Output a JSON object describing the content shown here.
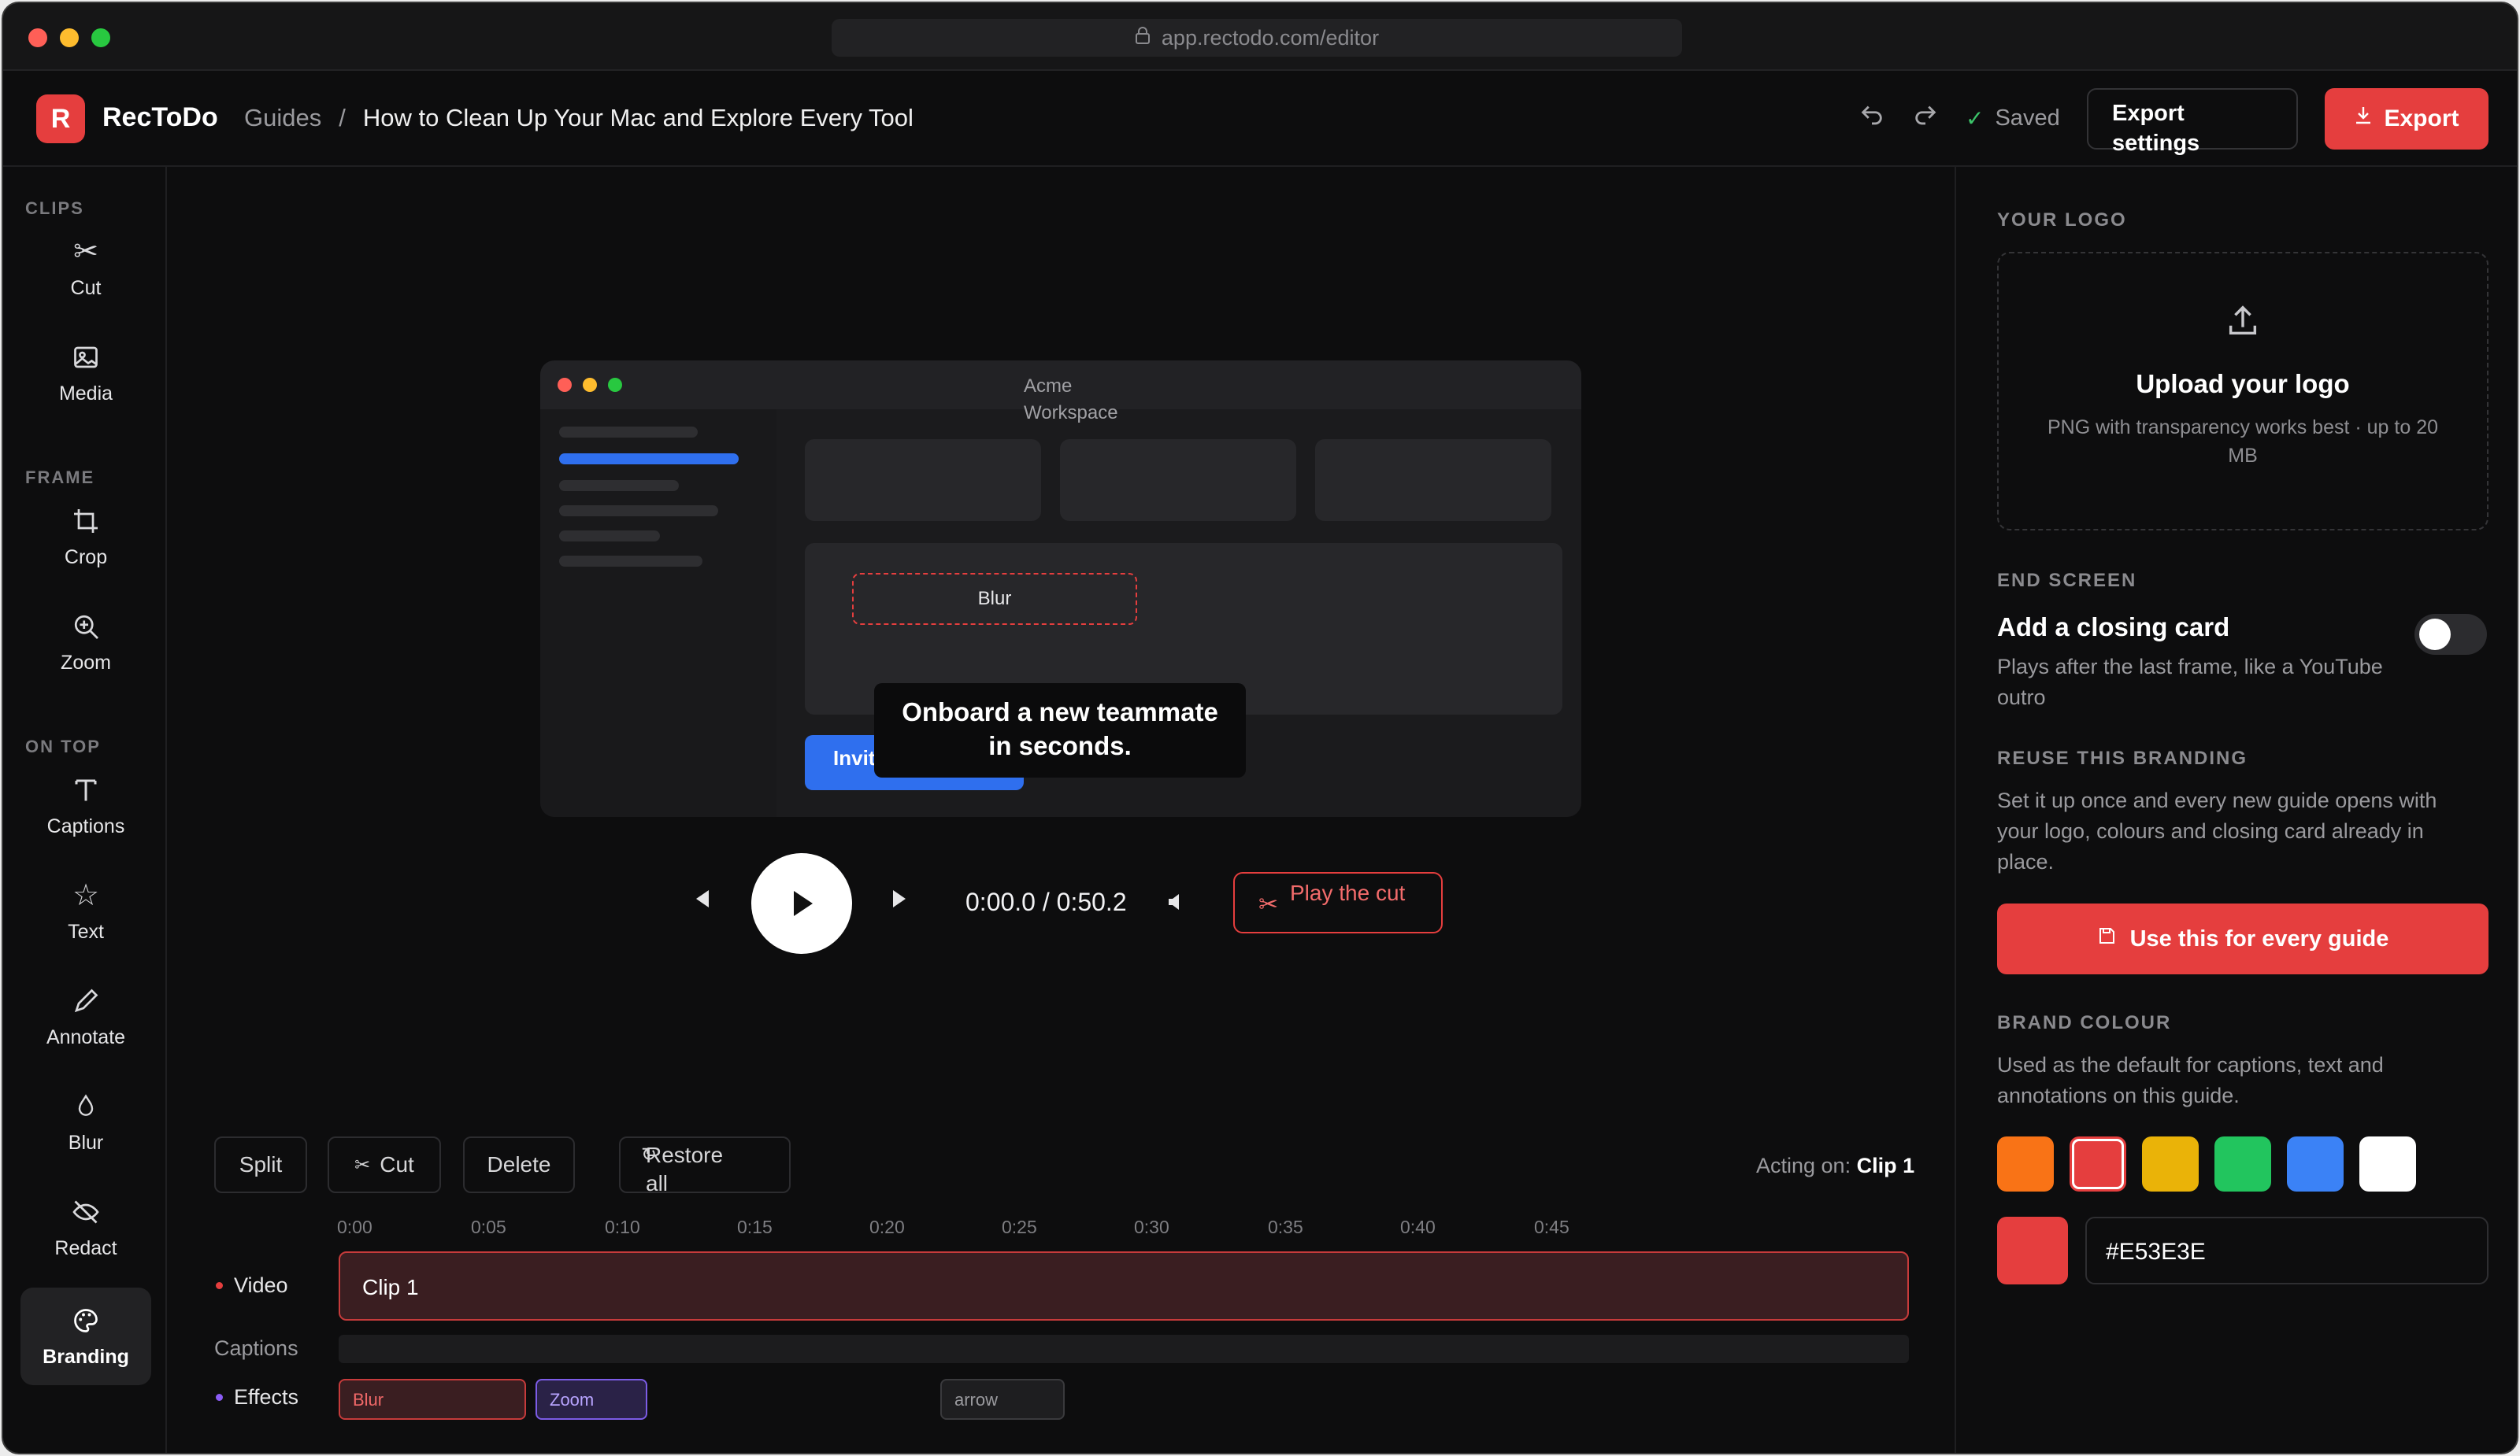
{
  "browser": {
    "url": "app.rectodo.com/editor",
    "lock_icon": "lock-icon"
  },
  "header": {
    "logo_letter": "R",
    "app_name": "RecToDo",
    "breadcrumb_parent": "Guides",
    "breadcrumb_sep": "/",
    "breadcrumb_current": "How to Clean Up Your Mac and Explore Every Tool",
    "saved_label": "Saved",
    "export_settings_label": "Export settings",
    "export_label": "Export"
  },
  "sidebar": {
    "sections": [
      "CLIPS",
      "FRAME",
      "ON TOP"
    ],
    "tools": [
      {
        "label": "Cut",
        "icon": "scissors-icon"
      },
      {
        "label": "Media",
        "icon": "image-icon"
      },
      {
        "label": "Crop",
        "icon": "crop-icon"
      },
      {
        "label": "Zoom",
        "icon": "zoom-in-icon"
      },
      {
        "label": "Captions",
        "icon": "text-cursor-icon"
      },
      {
        "label": "Text",
        "icon": "star-icon"
      },
      {
        "label": "Annotate",
        "icon": "pen-icon"
      },
      {
        "label": "Blur",
        "icon": "droplet-icon"
      },
      {
        "label": "Redact",
        "icon": "eye-off-icon"
      },
      {
        "label": "Branding",
        "icon": "palette-icon"
      }
    ],
    "active_tool": "Branding"
  },
  "preview": {
    "window_title": "Acme Workspace",
    "blur_label": "Blur",
    "invite_label": "Invite teammate",
    "caption_text": "Onboard a new teammate in seconds."
  },
  "playback": {
    "time": "0:00.0 / 0:50.2",
    "play_cut_label": "Play the cut"
  },
  "timeline": {
    "buttons": {
      "split": "Split",
      "cut": "Cut",
      "delete": "Delete",
      "restore": "Restore all"
    },
    "acting_on_label": "Acting on:",
    "acting_on_value": "Clip 1",
    "ticks": [
      "0:00",
      "0:05",
      "0:10",
      "0:15",
      "0:20",
      "0:25",
      "0:30",
      "0:35",
      "0:40",
      "0:45"
    ],
    "tracks": {
      "video": "Video",
      "captions": "Captions",
      "effects": "Effects"
    },
    "clip_label": "Clip 1",
    "effects": [
      "Blur",
      "Zoom",
      "arrow"
    ]
  },
  "right_panel": {
    "logo_section": "YOUR LOGO",
    "upload_title": "Upload your logo",
    "upload_hint": "PNG with transparency works best · up to 20 MB",
    "end_screen_section": "END SCREEN",
    "closing_card_title": "Add a closing card",
    "closing_card_desc": "Plays after the last frame, like a YouTube outro",
    "closing_card_enabled": false,
    "reuse_section": "REUSE THIS BRANDING",
    "reuse_desc": "Set it up once and every new guide opens with your logo, colours and closing card already in place.",
    "use_button": "Use this for every guide",
    "brand_section": "BRAND COLOUR",
    "brand_desc": "Used as the default for captions, text and annotations on this guide.",
    "swatches": [
      "#F97316",
      "#E53E3E",
      "#EAB308",
      "#22C55E",
      "#3B82F6",
      "#FFFFFF"
    ],
    "selected_swatch": "#E53E3E",
    "hex_value": "#E53E3E"
  }
}
